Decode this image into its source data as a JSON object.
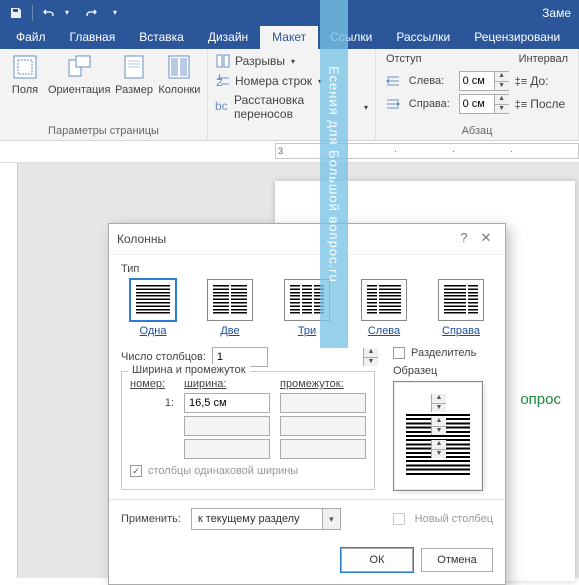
{
  "titlebar": {
    "right_text": "Заме"
  },
  "tabs": [
    "Файл",
    "Главная",
    "Вставка",
    "Дизайн",
    "Макет",
    "Ссылки",
    "Рассылки",
    "Рецензировани"
  ],
  "active_tab": 4,
  "ribbon": {
    "page_setup": {
      "fields": "Поля",
      "orientation": "Ориентация",
      "size": "Размер",
      "columns": "Колонки",
      "breaks": "Разрывы",
      "line_numbers": "Номера строк",
      "hyphenation": "Расстановка переносов",
      "group_label": "Параметры страницы"
    },
    "paragraph": {
      "indent_label": "Отступ",
      "spacing_label": "Интервал",
      "left": "Слева:",
      "right": "Справа:",
      "before": "До:",
      "after": "После",
      "left_val": "0 см",
      "right_val": "0 см",
      "group_label": "Абзац"
    }
  },
  "ruler": {
    "start": 3
  },
  "doc": {
    "visible_text": "опрос"
  },
  "watermark": "Есения для Большой вопрос.ru",
  "dialog": {
    "title": "Колонны",
    "type_label": "Тип",
    "presets": [
      {
        "label": "Одна",
        "cols": 1
      },
      {
        "label": "Две",
        "cols": 2
      },
      {
        "label": "Три",
        "cols": 3
      },
      {
        "label": "Слева",
        "cols": 2,
        "asym": "l"
      },
      {
        "label": "Справа",
        "cols": 2,
        "asym": "r"
      }
    ],
    "selected_preset": 0,
    "num_cols_label": "Число столбцов:",
    "num_cols": "1",
    "separator_label": "Разделитель",
    "width_group": "Ширина и промежуток",
    "sample_label": "Образец",
    "hdr_num": "номер:",
    "hdr_width": "ширина:",
    "hdr_gap": "промежуток:",
    "row1_num": "1:",
    "row1_width": "16,5 см",
    "equal_label": "столбцы одинаковой ширины",
    "apply_label": "Применить:",
    "apply_value": "к текущему разделу",
    "new_col_label": "Новый столбец",
    "ok": "ОК",
    "cancel": "Отмена"
  }
}
